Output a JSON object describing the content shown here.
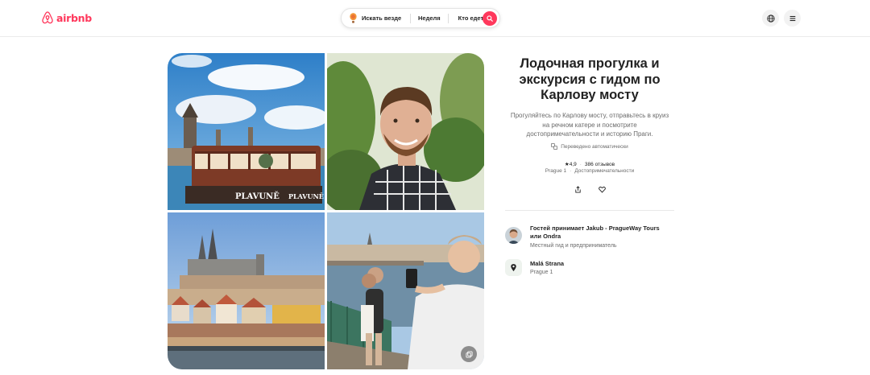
{
  "header": {
    "logo_text": "airbnb",
    "brand_color": "#ff385c",
    "search": {
      "where_label": "Искать везде",
      "when_label": "Неделя",
      "who_label": "Кто едет?"
    },
    "icons": [
      "globe-icon",
      "menu-icon",
      "search-icon",
      "balloon-icon"
    ]
  },
  "gallery": {
    "photos": [
      {
        "alt": "PLAVUNĚ boat near Charles Bridge"
      },
      {
        "alt": "Guide smiling outdoors"
      },
      {
        "alt": "Prague Castle and Lesser Town"
      },
      {
        "alt": "Guide photographing guests on bridge"
      }
    ],
    "boat_label": "PLAVUNĚ"
  },
  "experience": {
    "title": "Лодочная прогулка и экскурсия с гидом по Карлову мосту",
    "description": "Прогуляйтесь по Карлову мосту, отправьтесь в круиз на речном катере и посмотрите достопримечательности и историю Праги.",
    "translated_note": "Переведено автоматически",
    "rating": "★4,9",
    "reviews": "386 отзывов",
    "location": "Prague 1",
    "category": "Достопримечательности"
  },
  "host": {
    "name": "Гостей принимает Jakub - PragueWay Tours или Ondra",
    "subtitle": "Местный гид и предприниматель"
  },
  "place": {
    "name": "Malá Strana",
    "subtitle": "Prague 1"
  }
}
